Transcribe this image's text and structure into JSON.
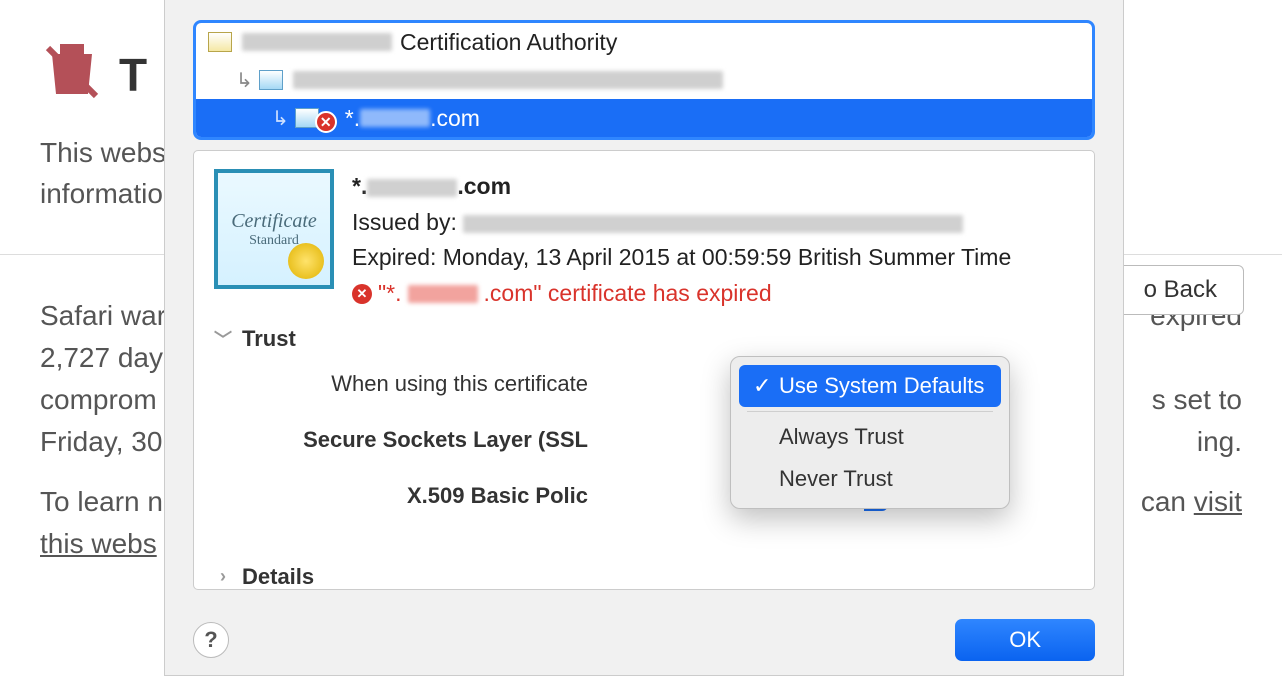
{
  "background": {
    "title_partial": "T",
    "subtext_line1_partial": "This webs",
    "subtext_line2_partial": "informatio",
    "go_back_partial": "o Back",
    "lower_l1": "Safari war",
    "lower_l1_right": " expired",
    "lower_l2": "2,727 day",
    "lower_l3": "comprom",
    "lower_l3_right": "s set to",
    "lower_l4": "Friday, 30",
    "lower_l4_right": "ing.",
    "lower_l5": "To learn n",
    "lower_l5_right_prefix": "can ",
    "link1": "visit",
    "link2": "this webs"
  },
  "chain": {
    "rows": [
      {
        "indent": 0,
        "text_suffix": " Certification Authority"
      },
      {
        "indent": 1,
        "text_suffix": ""
      },
      {
        "indent": 2,
        "text_prefix": "*.",
        "text_suffix": ".com",
        "selected": true,
        "error": true
      }
    ]
  },
  "cert": {
    "large_label_1": "Certificate",
    "large_label_2": "Standard",
    "name_prefix": "*.",
    "name_suffix": ".com",
    "issued_by_label": "Issued by: ",
    "expired_label": "Expired: Monday, 13 April 2015 at 00:59:59 British Summer Time",
    "error_prefix": "\"*.",
    "error_suffix": ".com\" certificate has expired"
  },
  "trust": {
    "section_label": "Trust",
    "when_label": "When using this certificate",
    "ssl_label": "Secure Sockets Layer (SSL",
    "x509_label": "X.509 Basic Polic",
    "help": "?"
  },
  "dropdown": {
    "opt1": "Use System Defaults",
    "opt2": "Always Trust",
    "opt3": "Never Trust"
  },
  "details_label": "Details",
  "footer": {
    "help": "?",
    "ok": "OK"
  }
}
